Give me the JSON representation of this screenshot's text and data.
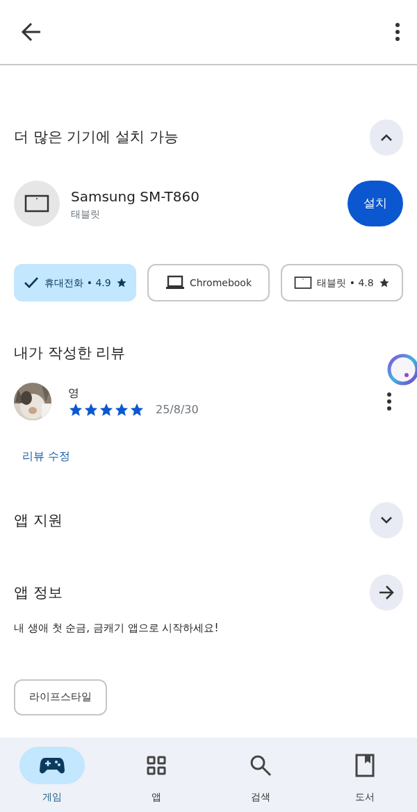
{
  "devices_section": {
    "title": "더 많은 기기에 설치 가능",
    "expanded": true,
    "device": {
      "name": "Samsung SM-T860",
      "type": "태블릿",
      "button": "설치"
    },
    "chips": [
      {
        "kind": "phone",
        "label": "휴대전화 • 4.9",
        "rated": true,
        "selected": true
      },
      {
        "kind": "laptop",
        "label": "Chromebook",
        "rated": false,
        "selected": false
      },
      {
        "kind": "tablet",
        "label": "태블릿 • 4.8",
        "rated": true,
        "selected": false
      }
    ]
  },
  "review_section": {
    "title": "내가 작성한 리뷰",
    "author": "영",
    "stars": 5,
    "date": "25/8/30",
    "edit_link": "리뷰 수정"
  },
  "sections": [
    {
      "kind": "expand",
      "title": "앱 지원"
    },
    {
      "kind": "arrow",
      "title": "앱 정보",
      "description": "내 생애 첫 순금, 금캐기 앱으로 시작하세요!"
    }
  ],
  "category_chip": "라이프스타일",
  "bottom_nav": [
    {
      "kind": "games",
      "label": "게임",
      "selected": true
    },
    {
      "kind": "apps",
      "label": "앱",
      "selected": false
    },
    {
      "kind": "search",
      "label": "검색",
      "selected": false
    },
    {
      "kind": "books",
      "label": "도서",
      "selected": false
    }
  ]
}
